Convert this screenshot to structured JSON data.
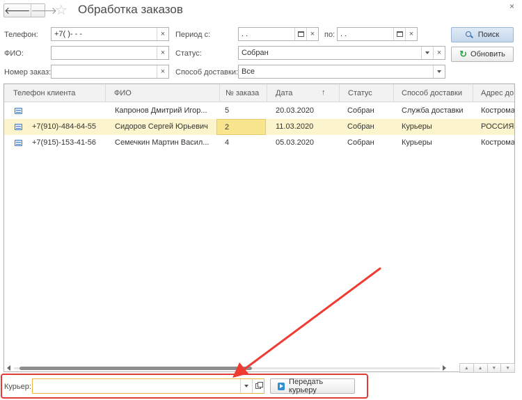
{
  "window": {
    "title": "Обработка заказов",
    "close_glyph": "×",
    "nav_back": "🡐",
    "nav_forward": "🡒",
    "star_glyph": "☆"
  },
  "filters": {
    "phone_label": "Телефон:",
    "phone_value": "+7(   )-   -  -",
    "fio_label": "ФИО:",
    "fio_value": "",
    "order_label": "Номер заказ:",
    "order_value": "",
    "period_label": "Период с:",
    "period_from": "  .  .",
    "period_to_label": "по:",
    "period_to": "  .  .",
    "status_label": "Статус:",
    "status_value": "Собран",
    "delivery_label": "Способ доставки:",
    "delivery_value": "Все",
    "clear_glyph": "×"
  },
  "buttons": {
    "search": "Поиск",
    "refresh": "Обновить",
    "refresh_glyph": "↻",
    "send_to_courier": "Передать курьеру"
  },
  "table": {
    "columns": [
      "Телефон клиента",
      "ФИО",
      "№ заказа",
      "Дата",
      "Статус",
      "Способ доставки",
      "Адрес до"
    ],
    "sort_glyph": "↑",
    "rows": [
      {
        "phone": "",
        "fio": "Капронов Дмитрий Игор...",
        "order": "5",
        "date": "20.03.2020",
        "status": "Собран",
        "delivery": "Служба доставки",
        "address": "Кострома"
      },
      {
        "phone": "+7(910)-484-64-55",
        "fio": "Сидоров Сергей Юрьевич",
        "order": "2",
        "date": "11.03.2020",
        "status": "Собран",
        "delivery": "Курьеры",
        "address": "РОССИЯ"
      },
      {
        "phone": "+7(915)-153-41-56",
        "fio": "Семечкин Мартин Васил...",
        "order": "4",
        "date": "05.03.2020",
        "status": "Собран",
        "delivery": "Курьеры",
        "address": "Кострома"
      }
    ],
    "selected_row": 1
  },
  "courier": {
    "label": "Курьер:",
    "value": ""
  },
  "scroll_buttons": [
    "▲",
    "▲",
    "▼",
    "▼"
  ],
  "colors": {
    "selected_row": "#fbf4cc",
    "selected_cell": "#f8e58d",
    "highlight_frame": "#e53935",
    "arrow": "#ef3b32",
    "search_button": "#c4d7ec"
  }
}
